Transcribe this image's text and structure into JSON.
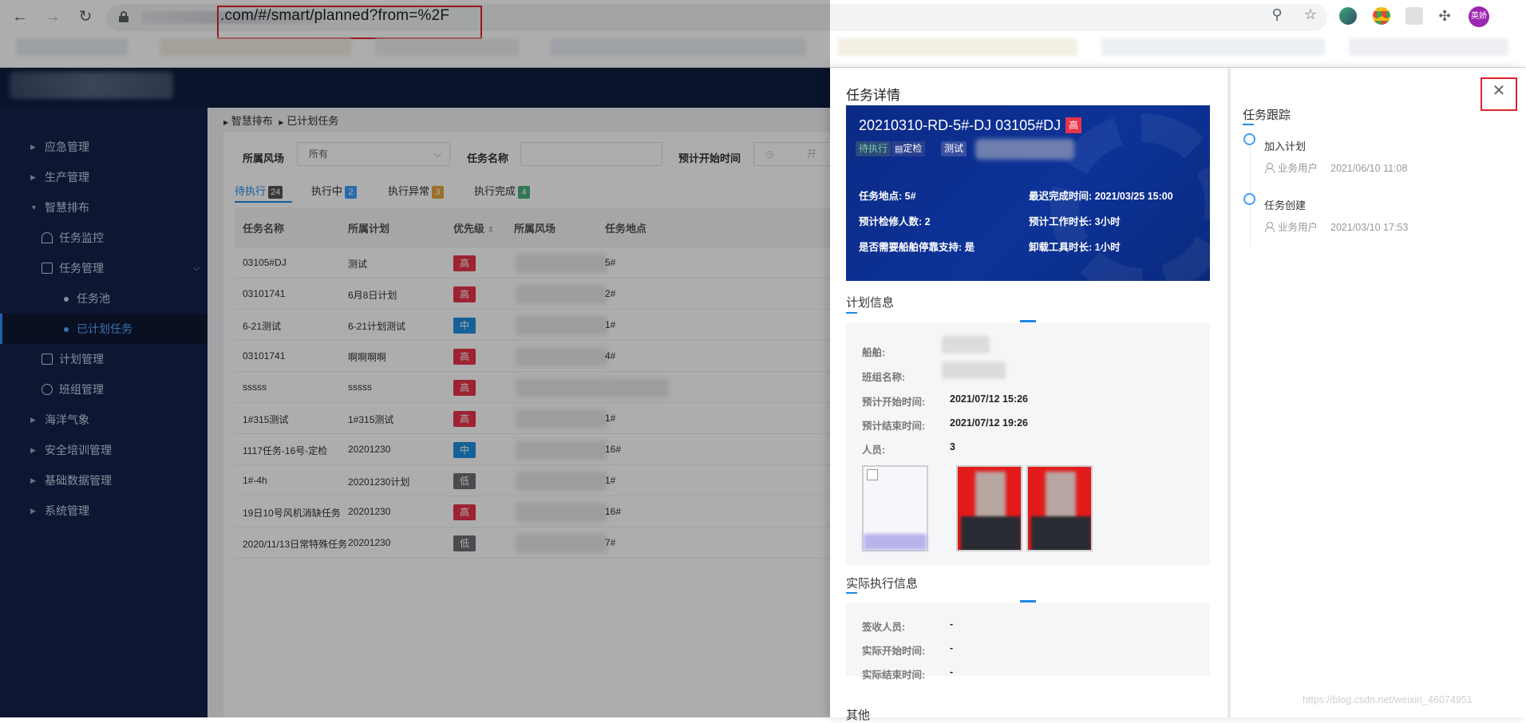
{
  "browser": {
    "url": ".com/#/smart/planned?from=%2F",
    "profile_label": "英娇"
  },
  "breadcrumb": [
    "智慧排布",
    "已计划任务"
  ],
  "sidebar": {
    "items": [
      {
        "label": "应急管理"
      },
      {
        "label": "生产管理"
      },
      {
        "label": "智慧排布"
      },
      {
        "label": "任务监控"
      },
      {
        "label": "任务管理"
      },
      {
        "label": "任务池"
      },
      {
        "label": "已计划任务"
      },
      {
        "label": "计划管理"
      },
      {
        "label": "班组管理"
      },
      {
        "label": "海洋气象"
      },
      {
        "label": "安全培训管理"
      },
      {
        "label": "基础数据管理"
      },
      {
        "label": "系统管理"
      }
    ]
  },
  "filters": {
    "wind_field_label": "所属风场",
    "wind_field_value": "所有",
    "task_name_label": "任务名称",
    "start_time_label": "预计开始时间",
    "start_time_placeholder": "开"
  },
  "tabs": [
    {
      "label": "待执行",
      "count": "24",
      "color": "#555555"
    },
    {
      "label": "执行中",
      "count": "2",
      "color": "#409eff"
    },
    {
      "label": "执行异常",
      "count": "3",
      "color": "#e6a23c"
    },
    {
      "label": "执行完成",
      "count": "4",
      "color": "#4cae7c"
    }
  ],
  "table": {
    "headers": [
      "任务名称",
      "所属计划",
      "优先级",
      "所属风场",
      "任务地点"
    ],
    "rows": [
      {
        "name": "03105#DJ",
        "plan": "测试",
        "priority": "高",
        "location": "5#"
      },
      {
        "name": "03101741",
        "plan": "6月8日计划",
        "priority": "高",
        "location": "2#"
      },
      {
        "name": "6-21测试",
        "plan": "6-21计划测试",
        "priority": "中",
        "location": "1#"
      },
      {
        "name": "03101741",
        "plan": "啊啊啊啊",
        "priority": "高",
        "location": "4#"
      },
      {
        "name": "sssss",
        "plan": "sssss",
        "priority": "高",
        "location": ""
      },
      {
        "name": "1#315测试",
        "plan": "1#315测试",
        "priority": "高",
        "location": "1#"
      },
      {
        "name": "1117任务-16号-定检",
        "plan": "20201230",
        "priority": "中",
        "location": "16#"
      },
      {
        "name": "1#-4h",
        "plan": "20201230计划",
        "priority": "低",
        "location": "1#"
      },
      {
        "name": "19日10号风机消缺任务",
        "plan": "20201230",
        "priority": "高",
        "location": "16#"
      },
      {
        "name": "2020/11/13日常特殊任务",
        "plan": "20201230",
        "priority": "低",
        "location": "7#"
      }
    ]
  },
  "priority_colors": {
    "高": "#e8334a",
    "中": "#1f8fe0",
    "低": "#6d6f73"
  },
  "drawer": {
    "title": "任务详情",
    "banner": {
      "code": "20210310-RD-5#-DJ 03105#DJ",
      "priority": "高",
      "tags": [
        "待执行",
        "定检",
        "测试"
      ],
      "site_label": "任务地点: 5#",
      "latest_finish": "最迟完成时间: 2021/03/25 15:00",
      "repair_count": "预计检修人数: 2",
      "work_time": "预计工作时长: 3小时",
      "ship_support": "是否需要船舶停靠支持: 是",
      "unload_time": "卸载工具时长: 1小时"
    },
    "plan_info": {
      "title": "计划信息",
      "ship_label": "船舶:",
      "team_label": "班组名称:",
      "start_label": "预计开始时间:",
      "start_value": "2021/07/12 15:26",
      "end_label": "预计结束时间:",
      "end_value": "2021/07/12 19:26",
      "staff_label": "人员:",
      "staff_value": "3"
    },
    "actual_info": {
      "title": "实际执行信息",
      "signer_label": "签收人员:",
      "signer_value": "-",
      "start_label": "实际开始时间:",
      "start_value": "-",
      "end_label": "实际结束时间:",
      "end_value": "-"
    },
    "other_title": "其他",
    "tracking": {
      "title": "任务跟踪",
      "events": [
        {
          "name": "加入计划",
          "user": "业务用户",
          "time": "2021/06/10 11:08"
        },
        {
          "name": "任务创建",
          "user": "业务用户",
          "time": "2021/03/10 17:53"
        }
      ]
    }
  },
  "watermark": "https://blog.csdn.net/weixin_46074951"
}
